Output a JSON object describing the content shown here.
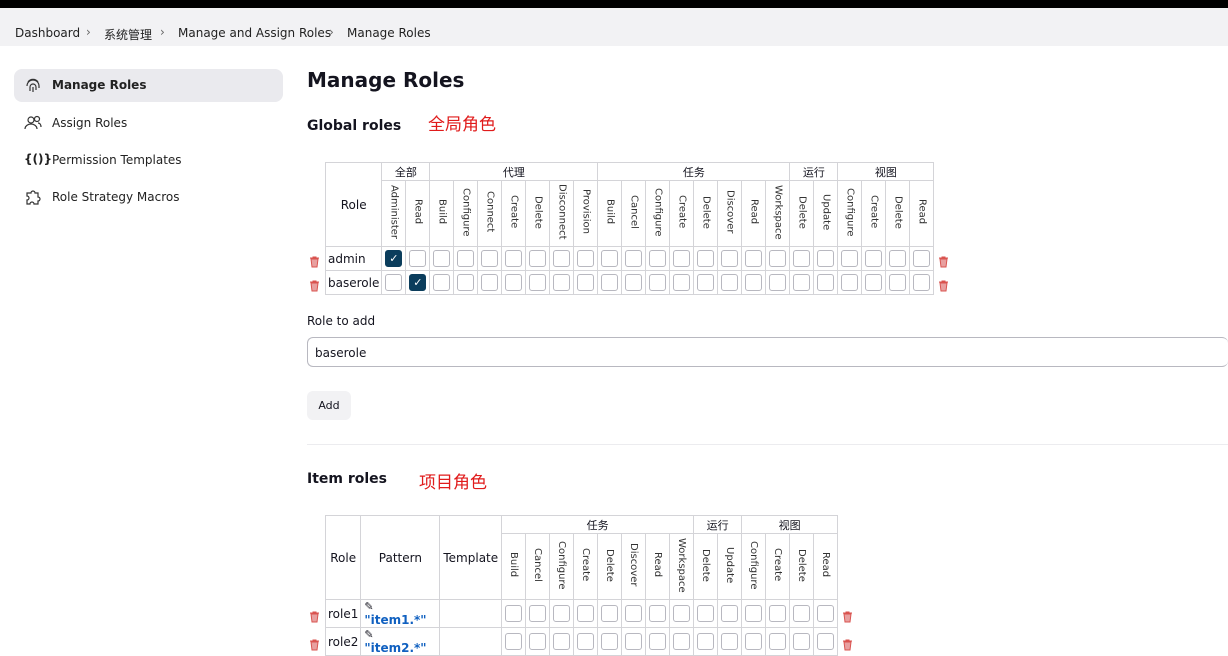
{
  "breadcrumbs": [
    "Dashboard",
    "系统管理",
    "Manage and Assign Roles",
    "Manage Roles"
  ],
  "sidebar": {
    "items": [
      {
        "label": "Manage Roles",
        "icon": "fingerprint-icon",
        "active": true
      },
      {
        "label": "Assign Roles",
        "icon": "people-icon"
      },
      {
        "label": "Permission Templates",
        "icon": "braces-icon"
      },
      {
        "label": "Role Strategy Macros",
        "icon": "puzzle-icon"
      }
    ]
  },
  "page_title": "Manage Roles",
  "global": {
    "heading": "Global roles",
    "annotation": "全局角色",
    "role_header": "Role",
    "groups": [
      {
        "name": "全部",
        "perms": [
          "Administer",
          "Read"
        ]
      },
      {
        "name": "代理",
        "perms": [
          "Build",
          "Configure",
          "Connect",
          "Create",
          "Delete",
          "Disconnect",
          "Provision"
        ]
      },
      {
        "name": "任务",
        "perms": [
          "Build",
          "Cancel",
          "Configure",
          "Create",
          "Delete",
          "Discover",
          "Read",
          "Workspace"
        ]
      },
      {
        "name": "运行",
        "perms": [
          "Delete",
          "Update"
        ]
      },
      {
        "name": "视图",
        "perms": [
          "Configure",
          "Create",
          "Delete",
          "Read"
        ]
      }
    ],
    "roles": [
      {
        "name": "admin",
        "checked": [
          0
        ]
      },
      {
        "name": "baserole",
        "checked": [
          1
        ]
      }
    ]
  },
  "role_to_add": {
    "label": "Role to add",
    "value": "baserole",
    "button": "Add"
  },
  "item": {
    "heading": "Item roles",
    "annotation": "项目角色",
    "headers": [
      "Role",
      "Pattern",
      "Template"
    ],
    "groups": [
      {
        "name": "任务",
        "perms": [
          "Build",
          "Cancel",
          "Configure",
          "Create",
          "Delete",
          "Discover",
          "Read",
          "Workspace"
        ]
      },
      {
        "name": "运行",
        "perms": [
          "Delete",
          "Update"
        ]
      },
      {
        "name": "视图",
        "perms": [
          "Configure",
          "Create",
          "Delete",
          "Read"
        ]
      }
    ],
    "roles": [
      {
        "name": "role1",
        "pattern": "\"item1.*\""
      },
      {
        "name": "role2",
        "pattern": "\"item2.*\""
      }
    ]
  },
  "colors": {
    "accent": "#0b3d5c",
    "annotation": "#e01b1b",
    "trash": "#d9534f"
  }
}
